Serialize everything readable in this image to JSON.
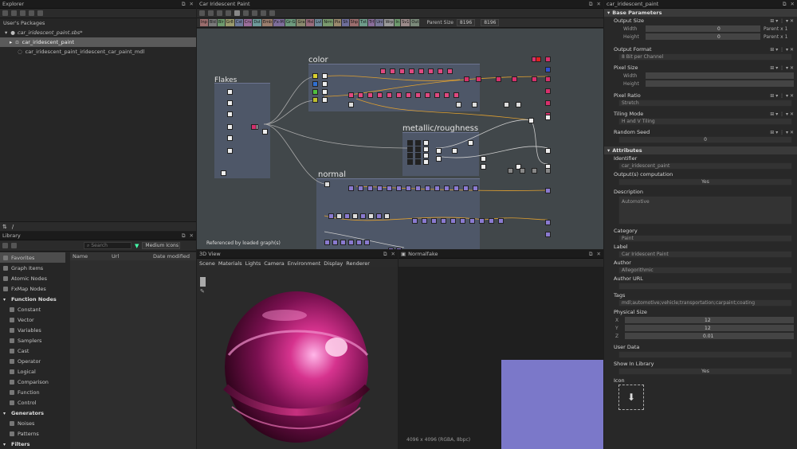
{
  "explorer": {
    "title": "Explorer",
    "root": "User's Packages",
    "package": "car_iridescent_paint.sbs*",
    "items": [
      "car_iridescent_paint",
      "car_iridescent_paint_iridescent_car_paint_mdl"
    ]
  },
  "library": {
    "title": "Library",
    "search_placeholder": "Search",
    "filter": "Medium Icons",
    "columns": [
      "Name",
      "Url",
      "Date modified"
    ],
    "categories": [
      {
        "label": "Favorites",
        "kind": "sel"
      },
      {
        "label": "Graph Items",
        "kind": "top"
      },
      {
        "label": "Atomic Nodes",
        "kind": "top"
      },
      {
        "label": "FxMap Nodes",
        "kind": "top"
      },
      {
        "label": "Function Nodes",
        "kind": "head"
      },
      {
        "label": "Constant",
        "kind": "sub"
      },
      {
        "label": "Vector",
        "kind": "sub"
      },
      {
        "label": "Variables",
        "kind": "sub"
      },
      {
        "label": "Samplers",
        "kind": "sub"
      },
      {
        "label": "Cast",
        "kind": "sub"
      },
      {
        "label": "Operator",
        "kind": "sub"
      },
      {
        "label": "Logical",
        "kind": "sub"
      },
      {
        "label": "Comparison",
        "kind": "sub"
      },
      {
        "label": "Function",
        "kind": "sub"
      },
      {
        "label": "Control",
        "kind": "sub"
      },
      {
        "label": "Generators",
        "kind": "head"
      },
      {
        "label": "Noises",
        "kind": "sub"
      },
      {
        "label": "Patterns",
        "kind": "sub"
      },
      {
        "label": "Filters",
        "kind": "head"
      }
    ]
  },
  "graph": {
    "title": "Car Iridescent Paint",
    "tags": [
      "Inp",
      "Bld",
      "Blr",
      "Gr8",
      "Cst",
      "Crv",
      "Dst",
      "Emb",
      "Fx-M",
      "Gr-G",
      "Gra",
      "Hsl",
      "Lvl",
      "Nrm",
      "Pix",
      "Sh",
      "Shp",
      "Txt",
      "Trf",
      "Uni",
      "Wrp",
      "In",
      "Sv1",
      "Out"
    ],
    "tag_colors": [
      "#9b6d6d",
      "#7a7a7a",
      "#6e9b6e",
      "#9b9b6e",
      "#6e7b9b",
      "#9b6e9b",
      "#6e9b9b",
      "#9b7e6e",
      "#7e6e9b",
      "#6e9b7e",
      "#8a8a6e",
      "#9b6e7e",
      "#6e8a9b",
      "#7a9b6e",
      "#9b8a6e",
      "#6e6e9b",
      "#9b6e6e",
      "#6e9b8a",
      "#8a6e9b",
      "#7a7a9b",
      "#9b9b9b",
      "#6e9b6e",
      "#9b8a8a",
      "#7a8a7a"
    ],
    "parent_size_label": "Parent Size",
    "parent_size_value": "8196",
    "size_value": "8196",
    "frames": [
      "Flakes",
      "color",
      "metallic/roughness",
      "normal"
    ],
    "footer": "Referenced by loaded graph(s)"
  },
  "view3d": {
    "title": "3D View",
    "menu": [
      "Scene",
      "Materials",
      "Lights",
      "Camera",
      "Environment",
      "Display",
      "Renderer"
    ]
  },
  "view2d": {
    "title": "Normalfake",
    "status": "4096 x 4096 (RGBA, 8bpc)"
  },
  "props": {
    "title": "car_iridescent_paint",
    "base_section": "Base Parameters",
    "output_size": "Output Size",
    "width_label": "Width",
    "height_label": "Height",
    "zero": "0",
    "parent_x1": "Parent x 1",
    "output_format": "Output Format",
    "output_format_value": "8 Bit per Channel",
    "pixel_size": "Pixel Size",
    "pixel_ratio": "Pixel Ratio",
    "pixel_ratio_value": "Stretch",
    "tiling_mode": "Tiling Mode",
    "tiling_value": "H and V Tiling",
    "random_seed": "Random Seed",
    "attributes_section": "Attributes",
    "identifier": "Identifier",
    "identifier_value": "car_iridescent_paint",
    "outputs_computation": "Output(s) computation",
    "yes": "Yes",
    "description": "Description",
    "description_value": "Automotive",
    "category": "Category",
    "category_value": "Paint",
    "label": "Label",
    "label_value": "Car Iridescent Paint",
    "author": "Author",
    "author_value": "Allegorithmic",
    "author_url": "Author URL",
    "tags": "Tags",
    "tags_value": "mdl;automotive;vehicle;transportation;carpaint;coating",
    "physical_size": "Physical Size",
    "physical_values": [
      "12",
      "12",
      "0.01"
    ],
    "axes": [
      "X",
      "Y",
      "Z"
    ],
    "user_data": "User Data",
    "show_in_library": "Show In Library",
    "icon": "Icon"
  }
}
